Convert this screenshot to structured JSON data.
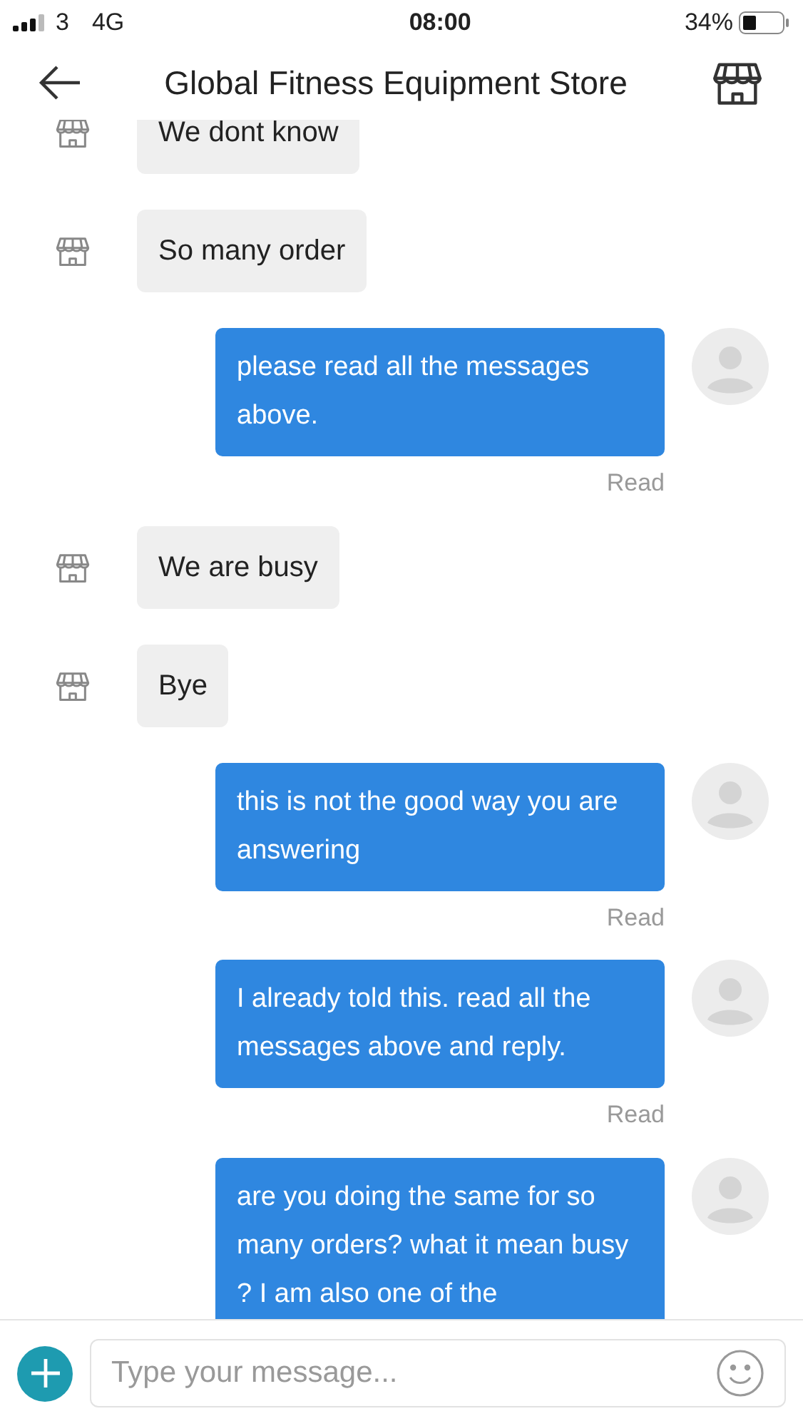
{
  "status_bar": {
    "carrier": "3",
    "network": "4G",
    "time": "08:00",
    "battery_percent": "34%"
  },
  "header": {
    "title": "Global Fitness Equipment Store"
  },
  "messages": [
    {
      "kind": "received",
      "text": "We dont know"
    },
    {
      "kind": "received",
      "text": "So many order"
    },
    {
      "kind": "sent",
      "text": "please read all the messages above.",
      "status": "Read"
    },
    {
      "kind": "received",
      "text": "We are busy"
    },
    {
      "kind": "received",
      "text": "Bye"
    },
    {
      "kind": "sent",
      "text": "this is not the good way you are answering",
      "status": "Read"
    },
    {
      "kind": "sent",
      "text": "I already told this. read all the messages above and reply.",
      "status": "Read"
    },
    {
      "kind": "sent",
      "text": "are you doing the same for so many orders? what it mean busy ? I am also one of the"
    }
  ],
  "composer": {
    "placeholder": "Type your message..."
  }
}
